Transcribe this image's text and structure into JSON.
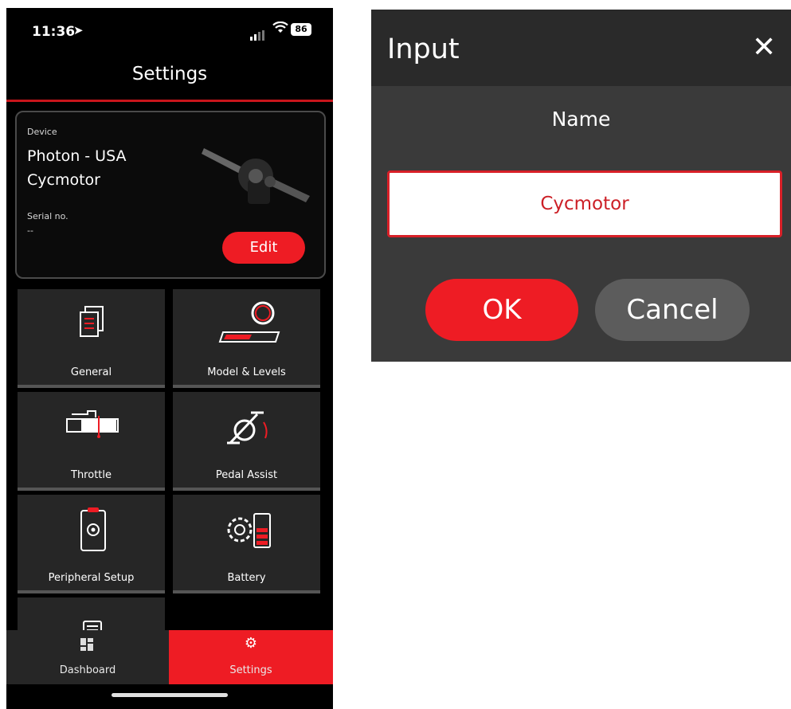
{
  "status_bar": {
    "time": "11:36",
    "battery": "86"
  },
  "screen_title": "Settings",
  "device_card": {
    "device_label": "Device",
    "device_name_line1": "Photon - USA",
    "device_name_line2": "Cycmotor",
    "serial_label": "Serial no.",
    "serial_value": "--",
    "edit_label": "Edit"
  },
  "tiles": {
    "general": "General",
    "model_levels": "Model & Levels",
    "throttle": "Throttle",
    "pedal_assist": "Pedal Assist",
    "peripheral_setup": "Peripheral Setup",
    "battery": "Battery"
  },
  "bottom_nav": {
    "dashboard": "Dashboard",
    "settings": "Settings"
  },
  "dialog": {
    "title": "Input",
    "close_glyph": "✕",
    "field_label": "Name",
    "field_value": "Cycmotor",
    "ok_label": "OK",
    "cancel_label": "Cancel"
  },
  "colors": {
    "accent_red": "#ee1c24",
    "tile_bg": "#262626",
    "dialog_bg": "#3a3a3a"
  }
}
